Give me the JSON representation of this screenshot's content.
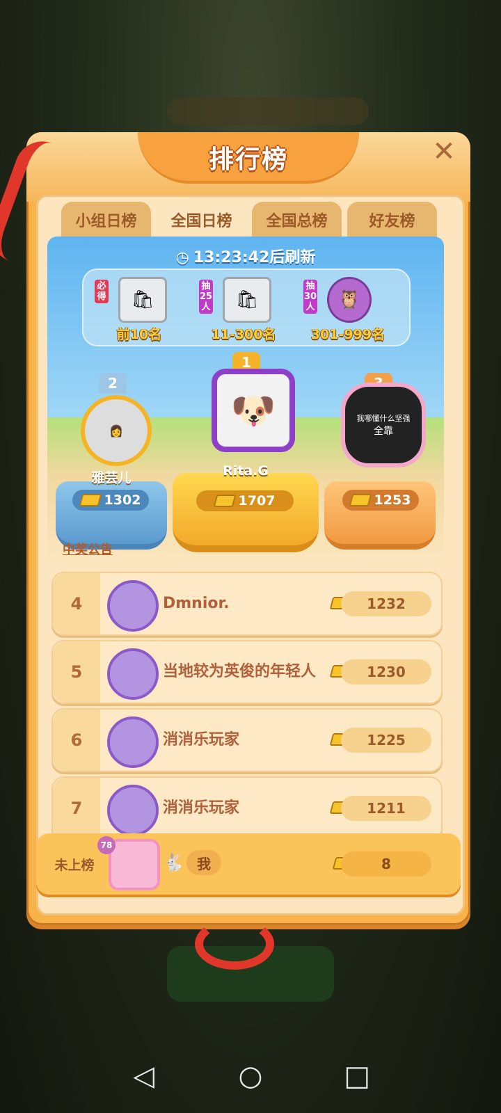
{
  "header": {
    "title": "排行榜",
    "close_label": "✕"
  },
  "tabs": [
    {
      "label": "小组日榜",
      "active": false
    },
    {
      "label": "全国日榜",
      "active": true
    },
    {
      "label": "全国总榜",
      "active": false
    },
    {
      "label": "好友榜",
      "active": false
    }
  ],
  "timer": {
    "text": "13:23:42后刷新"
  },
  "rewards": [
    {
      "tag": "必得",
      "label": "前10名"
    },
    {
      "tag": "抽25人",
      "label": "11-300名"
    },
    {
      "tag": "抽30人",
      "label": "301-999名"
    }
  ],
  "podium": {
    "first": {
      "rank": "1",
      "name": "Rita.G",
      "score": "1707"
    },
    "second": {
      "rank": "2",
      "name": "雅芸儿",
      "score": "1302"
    },
    "third": {
      "rank": "3",
      "name": "",
      "score": "1253",
      "avatar_text_1": "我哪懂什么坚强",
      "avatar_text_2": "全靠"
    }
  },
  "announcement": "中奖公告",
  "list": [
    {
      "rank": "4",
      "name": "Dmnior.",
      "score": "1232"
    },
    {
      "rank": "5",
      "name": "当地较为英俊的年轻人",
      "score": "1230"
    },
    {
      "rank": "6",
      "name": "消消乐玩家",
      "score": "1225"
    },
    {
      "rank": "7",
      "name": "消消乐玩家",
      "score": "1211"
    }
  ],
  "me": {
    "rank_label": "未上榜",
    "level": "78",
    "name": "我",
    "score": "8"
  },
  "navbar": {
    "back": "◁",
    "home": "○",
    "recents": "□"
  }
}
